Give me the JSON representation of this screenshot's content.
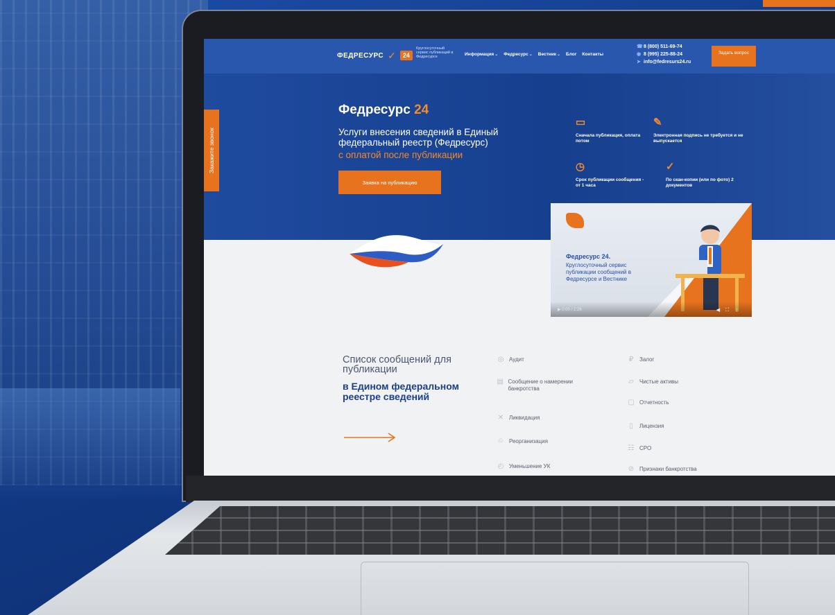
{
  "header": {
    "logo_text": "ФЕДРЕСУРС",
    "logo_badge": "24",
    "tagline": "Круглосуточный сервис публикаций в Федресурсе",
    "nav": [
      {
        "label": "Информация",
        "has_dropdown": true
      },
      {
        "label": "Федресурс",
        "has_dropdown": true
      },
      {
        "label": "Вестник",
        "has_dropdown": true
      },
      {
        "label": "Блог",
        "has_dropdown": false
      },
      {
        "label": "Контакты",
        "has_dropdown": false
      }
    ],
    "phone1": "8 (800) 511-69-74",
    "phone2": "8 (995) 225-88-24",
    "email": "info@fedresurs24.ru",
    "ask_button": "Задать вопрос"
  },
  "side_tab": "Закажите звонок",
  "hero": {
    "title": "Федресурс",
    "title_num": "24",
    "subtitle": "Услуги внесения сведений в Единый федеральный реестр (Федресурс)",
    "subtitle_accent": "с оплатой после публикации",
    "apply_button": "Заявка на публикацию"
  },
  "features": [
    {
      "icon": "monitor-icon",
      "glyph": "▭",
      "text": "Сначала публикация, оплата потом"
    },
    {
      "icon": "pen-icon",
      "glyph": "✎",
      "text": "Электронная подпись не требуется и не выпускается"
    },
    {
      "icon": "clock-icon",
      "glyph": "◷",
      "text": "Срок публикации сообщения - от 1 часа"
    },
    {
      "icon": "check-circle-icon",
      "glyph": "✓",
      "text": "По скан-копии (или по фото) 2 документов"
    }
  ],
  "video": {
    "title": "Федресурс 24.",
    "description": "Круглосуточный сервис публикации сообщений в Федресурсе и Вестнике",
    "time": "0:00 / 1:26"
  },
  "messages": {
    "title_line": "Список сообщений для публикации",
    "title_bold": "в Едином федеральном реестре сведений",
    "col1": [
      {
        "icon": "audit-icon",
        "label": "Аудит"
      },
      {
        "icon": "bankruptcy-intent-icon",
        "label": "Сообщение о намерении банкротства"
      },
      {
        "icon": "liquidation-icon",
        "label": "Ликвидация"
      },
      {
        "icon": "reorganization-icon",
        "label": "Реорганизация"
      },
      {
        "icon": "capital-reduction-icon",
        "label": "Уменьшение УК"
      }
    ],
    "col2": [
      {
        "icon": "pledge-icon",
        "label": "Залог"
      },
      {
        "icon": "net-assets-icon",
        "label": "Чистые активы"
      },
      {
        "icon": "reporting-icon",
        "label": "Отчетность"
      },
      {
        "icon": "license-icon",
        "label": "Лицензия"
      },
      {
        "icon": "sro-icon",
        "label": "СРО"
      },
      {
        "icon": "bankruptcy-signs-icon",
        "label": "Признаки банкротства"
      }
    ]
  },
  "colors": {
    "primary": "#2957ad",
    "accent": "#e8731f",
    "dark": "#123a86"
  }
}
